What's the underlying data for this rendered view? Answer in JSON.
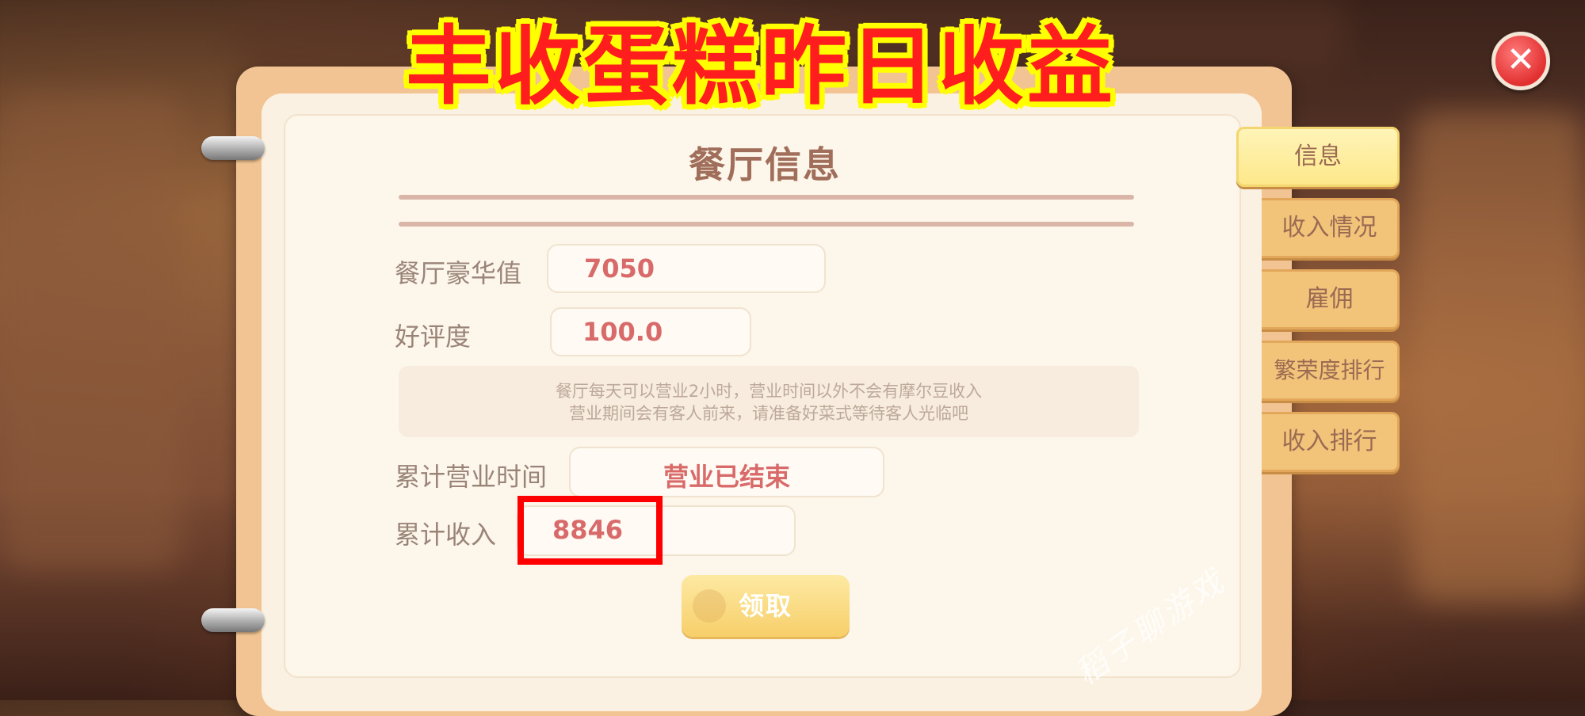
{
  "overlay": {
    "headline": "丰收蛋糕昨日收益",
    "watermark": "稻子聊游戏"
  },
  "close": {
    "label": "✕"
  },
  "panel": {
    "title": "餐厅信息",
    "fields": {
      "luxury": {
        "label": "餐厅豪华值",
        "value": "7050"
      },
      "rating": {
        "label": "好评度",
        "value": "100.0"
      },
      "business_time": {
        "label": "累计营业时间",
        "value": "营业已结束"
      },
      "income": {
        "label": "累计收入",
        "value": "8846"
      }
    },
    "notice": {
      "line1": "餐厅每天可以营业2小时，营业时间以外不会有摩尔豆收入",
      "line2": "营业期间会有客人前来，请准备好菜式等待客人光临吧"
    },
    "claim_button": "领取"
  },
  "tabs": [
    {
      "label": "信息",
      "active": true
    },
    {
      "label": "收入情况",
      "active": false
    },
    {
      "label": "雇佣",
      "active": false
    },
    {
      "label": "繁荣度排行",
      "active": false
    },
    {
      "label": "收入排行",
      "active": false
    }
  ]
}
